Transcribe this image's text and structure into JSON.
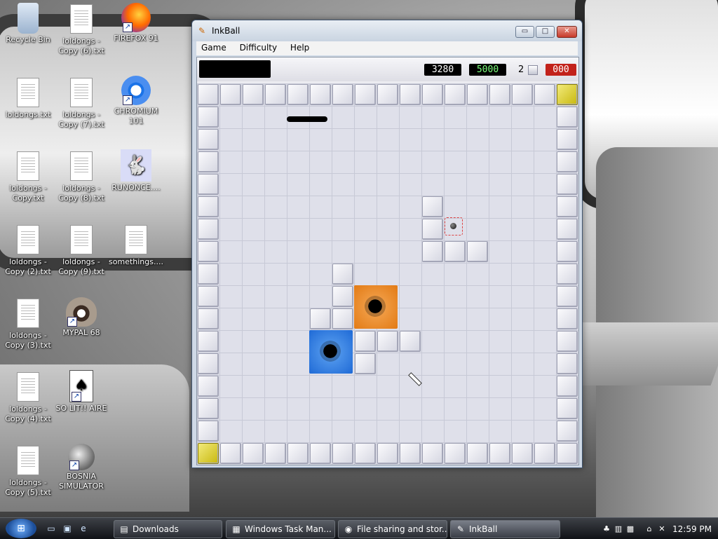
{
  "desktop": {
    "icons": [
      {
        "label": "Recycle Bin"
      },
      {
        "label": "loldongs - Copy (6).txt"
      },
      {
        "label": "FIREFOX 91"
      },
      {
        "label": "loldongs.txt"
      },
      {
        "label": "loldongs - Copy (7).txt"
      },
      {
        "label": "CHROMIUM 101"
      },
      {
        "label": "loldongs - Copy.txt"
      },
      {
        "label": "loldongs - Copy (8).txt"
      },
      {
        "label": "RUNONCE...."
      },
      {
        "label": "loldongs - Copy (2).txt"
      },
      {
        "label": "loldongs - Copy (9).txt"
      },
      {
        "label": "somethings...."
      },
      {
        "label": "loldongs - Copy (3).txt"
      },
      {
        "label": "MYPAL 68"
      },
      {
        "label": "loldongs - Copy (4).txt"
      },
      {
        "label": "SO LIT!! AIRE"
      },
      {
        "label": "loldongs - Copy (5).txt"
      },
      {
        "label": "BOSNIA SIMULATOR"
      }
    ]
  },
  "window": {
    "title": "InkBall",
    "controls": {
      "minimize": "▭",
      "maximize": "□",
      "close": "✕"
    },
    "menu": [
      "Game",
      "Difficulty",
      "Help"
    ]
  },
  "hud": {
    "score": "3280",
    "target": "5000",
    "balls_remaining": "2",
    "time": "000"
  },
  "taskbar": {
    "buttons": [
      {
        "label": "Downloads"
      },
      {
        "label": "Windows Task Man..."
      },
      {
        "label": "File sharing and stor..."
      },
      {
        "label": "InkBall"
      }
    ],
    "clock": "12:59 PM"
  },
  "colors": {
    "board": "#dfe0ea",
    "orange_hole": "#e27a14",
    "blue_hole": "#1f6ad6",
    "gold_tile": "#d8ca1e"
  }
}
